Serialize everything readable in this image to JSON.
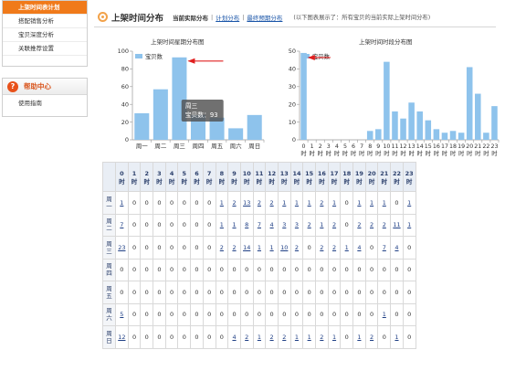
{
  "sidebar": {
    "items": [
      {
        "label": "上架时间表计划",
        "active": true
      },
      {
        "label": "搭配销售分析",
        "active": false
      },
      {
        "label": "宝贝深度分析",
        "active": false
      },
      {
        "label": "关联推荐设置",
        "active": false
      }
    ],
    "help_title": "帮助中心",
    "help_items": [
      "使用指南"
    ]
  },
  "header": {
    "title": "上架时间分布",
    "tabs": [
      "当前实际分布",
      "计划分布",
      "最终预期分布"
    ],
    "note": "(以下图表展示了：所有宝贝的当前实际上架时间分布)"
  },
  "chart_data": [
    {
      "type": "bar",
      "title": "上架时间星期分布图",
      "legend": "宝贝数",
      "legend_position": "top-left",
      "categories": [
        "周一",
        "周二",
        "周三",
        "周四",
        "周五",
        "周六",
        "周日"
      ],
      "values": [
        30,
        57,
        93,
        28,
        25,
        13,
        28
      ],
      "ylim": [
        0,
        100
      ],
      "yticks": [
        0,
        20,
        40,
        60,
        80,
        100
      ],
      "bar_color": "#8ec3ec",
      "tooltip": {
        "title": "周三",
        "text": "宝贝数：93"
      }
    },
    {
      "type": "bar",
      "title": "上架时间时段分布图",
      "legend": "宝贝数",
      "legend_position": "top-left",
      "categories": [
        "0时",
        "1时",
        "2时",
        "3时",
        "4时",
        "5时",
        "6时",
        "7时",
        "8时",
        "9时",
        "10时",
        "11时",
        "12时",
        "13时",
        "14时",
        "15时",
        "16时",
        "17时",
        "18时",
        "19时",
        "20时",
        "21时",
        "22时",
        "23时"
      ],
      "values": [
        49,
        0,
        0,
        0,
        0,
        0,
        0,
        0,
        5,
        6,
        44,
        16,
        12,
        21,
        16,
        11,
        6,
        4,
        5,
        4,
        41,
        26,
        4,
        19
      ],
      "ylim": [
        0,
        50
      ],
      "yticks": [
        0,
        10,
        20,
        30,
        40,
        50
      ],
      "bar_color": "#8ec3ec"
    }
  ],
  "table": {
    "hours": [
      "0时",
      "1时",
      "2时",
      "3时",
      "4时",
      "5时",
      "6时",
      "7时",
      "8时",
      "9时",
      "10时",
      "11时",
      "12时",
      "13时",
      "14时",
      "15时",
      "16时",
      "17时",
      "18时",
      "19时",
      "20时",
      "21时",
      "22时",
      "23时"
    ],
    "rows": [
      {
        "day": "周一",
        "values": [
          "1",
          "0",
          "0",
          "0",
          "0",
          "0",
          "0",
          "0",
          "1",
          "2",
          "13",
          "2",
          "2",
          "1",
          "1",
          "1",
          "2",
          "1",
          "0",
          "1",
          "1",
          "1",
          "0",
          "1"
        ]
      },
      {
        "day": "周二",
        "values": [
          "7",
          "0",
          "0",
          "0",
          "0",
          "0",
          "0",
          "0",
          "1",
          "1",
          "8",
          "7",
          "4",
          "3",
          "3",
          "2",
          "1",
          "2",
          "0",
          "2",
          "2",
          "2",
          "11",
          "1"
        ]
      },
      {
        "day": "周三",
        "values": [
          "23",
          "0",
          "0",
          "0",
          "0",
          "0",
          "0",
          "0",
          "2",
          "2",
          "14",
          "1",
          "1",
          "10",
          "2",
          "0",
          "2",
          "2",
          "1",
          "4",
          "0",
          "7",
          "4",
          "0"
        ]
      },
      {
        "day": "周四",
        "values": [
          "0",
          "0",
          "0",
          "0",
          "0",
          "0",
          "0",
          "0",
          "0",
          "0",
          "0",
          "0",
          "0",
          "0",
          "0",
          "0",
          "0",
          "0",
          "0",
          "0",
          "0",
          "0",
          "0",
          "0"
        ]
      },
      {
        "day": "周五",
        "values": [
          "0",
          "0",
          "0",
          "0",
          "0",
          "0",
          "0",
          "0",
          "0",
          "0",
          "0",
          "0",
          "0",
          "0",
          "0",
          "0",
          "0",
          "0",
          "0",
          "0",
          "0",
          "0",
          "0",
          "0"
        ]
      },
      {
        "day": "周六",
        "values": [
          "5",
          "0",
          "0",
          "0",
          "0",
          "0",
          "0",
          "0",
          "0",
          "0",
          "0",
          "0",
          "0",
          "0",
          "0",
          "0",
          "0",
          "0",
          "0",
          "0",
          "0",
          "1",
          "0",
          "0"
        ]
      },
      {
        "day": "周日",
        "values": [
          "12",
          "0",
          "0",
          "0",
          "0",
          "0",
          "0",
          "0",
          "0",
          "4",
          "2",
          "1",
          "2",
          "2",
          "1",
          "1",
          "2",
          "1",
          "0",
          "1",
          "2",
          "0",
          "1",
          "0"
        ]
      }
    ]
  }
}
